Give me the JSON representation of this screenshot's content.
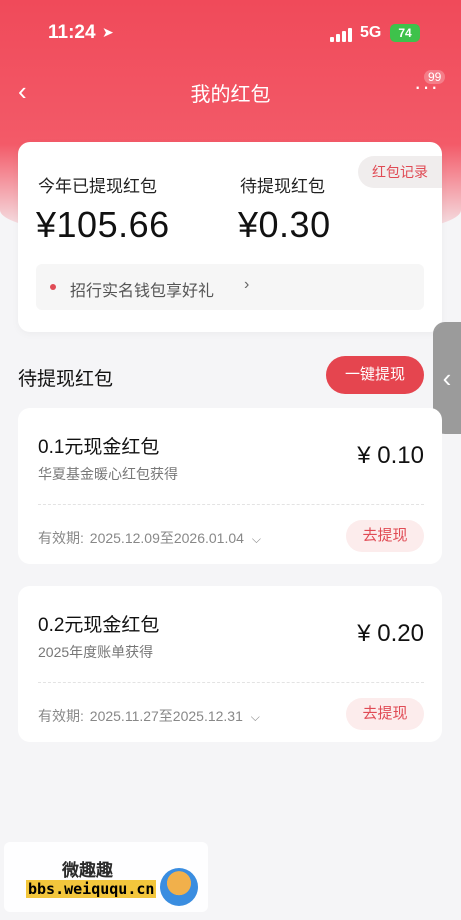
{
  "status": {
    "time": "11:24",
    "network": "5G",
    "battery": "74"
  },
  "nav": {
    "back_icon": "‹",
    "title": "我的红包",
    "more_icon": "···",
    "badge": "99"
  },
  "summary": {
    "record_label": "红包记录",
    "withdrawn_label": "今年已提现红包",
    "withdrawn_value": "¥105.66",
    "pending_label": "待提现红包",
    "pending_value": "¥0.30",
    "promo_text": "招行实名钱包享好礼",
    "promo_arrow": "›"
  },
  "pending_section": {
    "title": "待提现红包",
    "oneclick_label": "一键提现"
  },
  "side_tab_icon": "‹",
  "packets": [
    {
      "name": "0.1元现金红包",
      "source": "华夏基金暖心红包获得",
      "amount": "¥ 0.10",
      "validity_label": "有效期:",
      "validity": "2025.12.09至2026.01.04",
      "chevron": "⌵",
      "button": "去提现"
    },
    {
      "name": "0.2元现金红包",
      "source": "2025年度账单获得",
      "amount": "¥ 0.20",
      "validity_label": "有效期:",
      "validity": "2025.11.27至2025.12.31",
      "chevron": "⌵",
      "button": "去提现"
    }
  ],
  "watermark": {
    "cn": "微趣趣",
    "url": "bbs.weiququ.cn"
  },
  "colors": {
    "brand_red": "#e5454f",
    "header_gradient": "#f04a5a"
  }
}
